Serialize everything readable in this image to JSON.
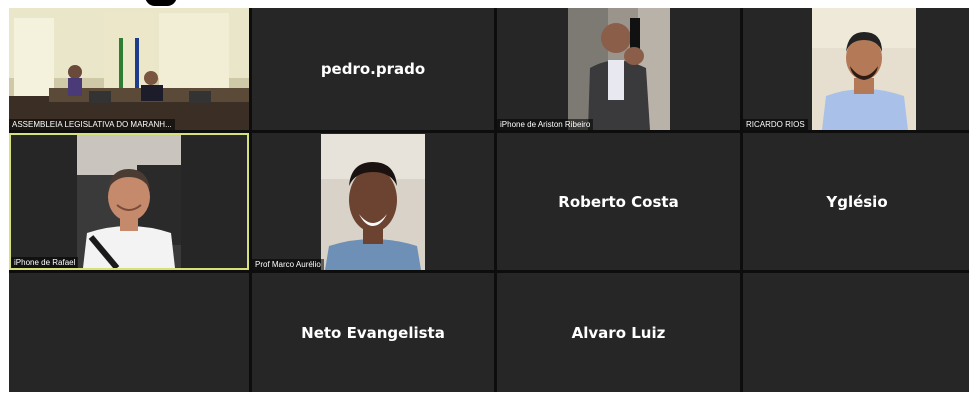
{
  "participants": [
    {
      "name": "ASSEMBLEIA LEGISLATIVA DO MARANH..."
    },
    {
      "name": "pedro.prado"
    },
    {
      "name": "iPhone de Ariston Ribeiro"
    },
    {
      "name": "RICARDO RIOS"
    },
    {
      "name": "iPhone de Rafael"
    },
    {
      "name": "Prof Marco Aurélio"
    },
    {
      "name": "Roberto Costa"
    },
    {
      "name": "Yglésio"
    },
    {
      "name": "Neto Evangelista"
    },
    {
      "name": "Alvaro Luiz"
    }
  ]
}
